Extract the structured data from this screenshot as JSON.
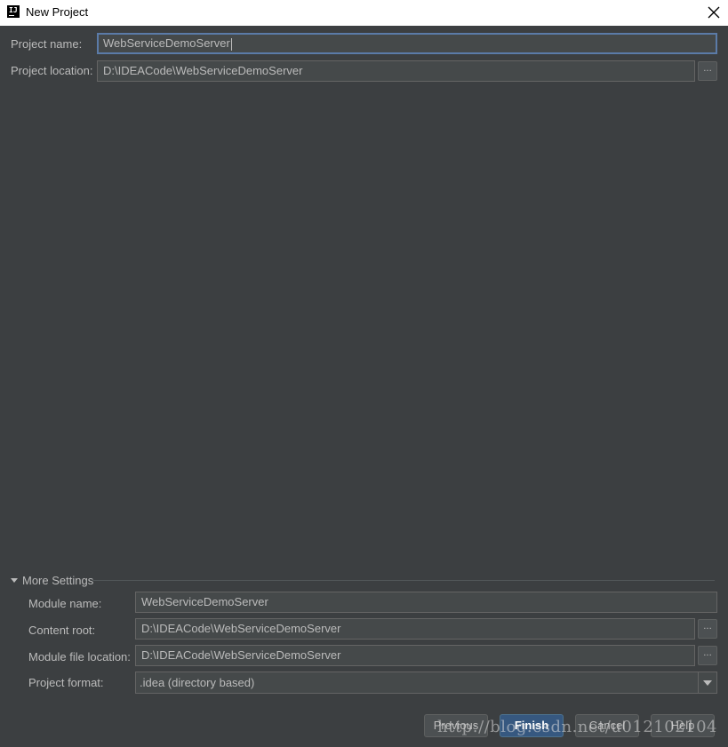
{
  "window": {
    "title": "New Project",
    "logo_text": "IJ",
    "close_glyph": "✕"
  },
  "project": {
    "name_label": "Project name:",
    "name_value": "WebServiceDemoServer",
    "location_label": "Project location:",
    "location_value": "D:\\IDEACode\\WebServiceDemoServer",
    "browse_label": "..."
  },
  "more_settings": {
    "toggle_label": "More Settings",
    "module_name_label": "Module name:",
    "module_name_value": "WebServiceDemoServer",
    "content_root_label": "Content root:",
    "content_root_value": "D:\\IDEACode\\WebServiceDemoServer",
    "module_file_location_label": "Module file location:",
    "module_file_location_value": "D:\\IDEACode\\WebServiceDemoServer",
    "project_format_label": "Project format:",
    "project_format_value": ".idea (directory based)",
    "browse_label": "..."
  },
  "buttons": {
    "previous": "Previous",
    "finish": "Finish",
    "cancel": "Cancel",
    "help": "Help"
  },
  "watermark": {
    "text": "http://blog.csdn.net/u012102104"
  },
  "colors": {
    "background": "#3c3f41",
    "field_background": "#45494a",
    "focus_border": "#5b7ba8",
    "primary_button": "#365880",
    "text": "#bbbbbb"
  }
}
